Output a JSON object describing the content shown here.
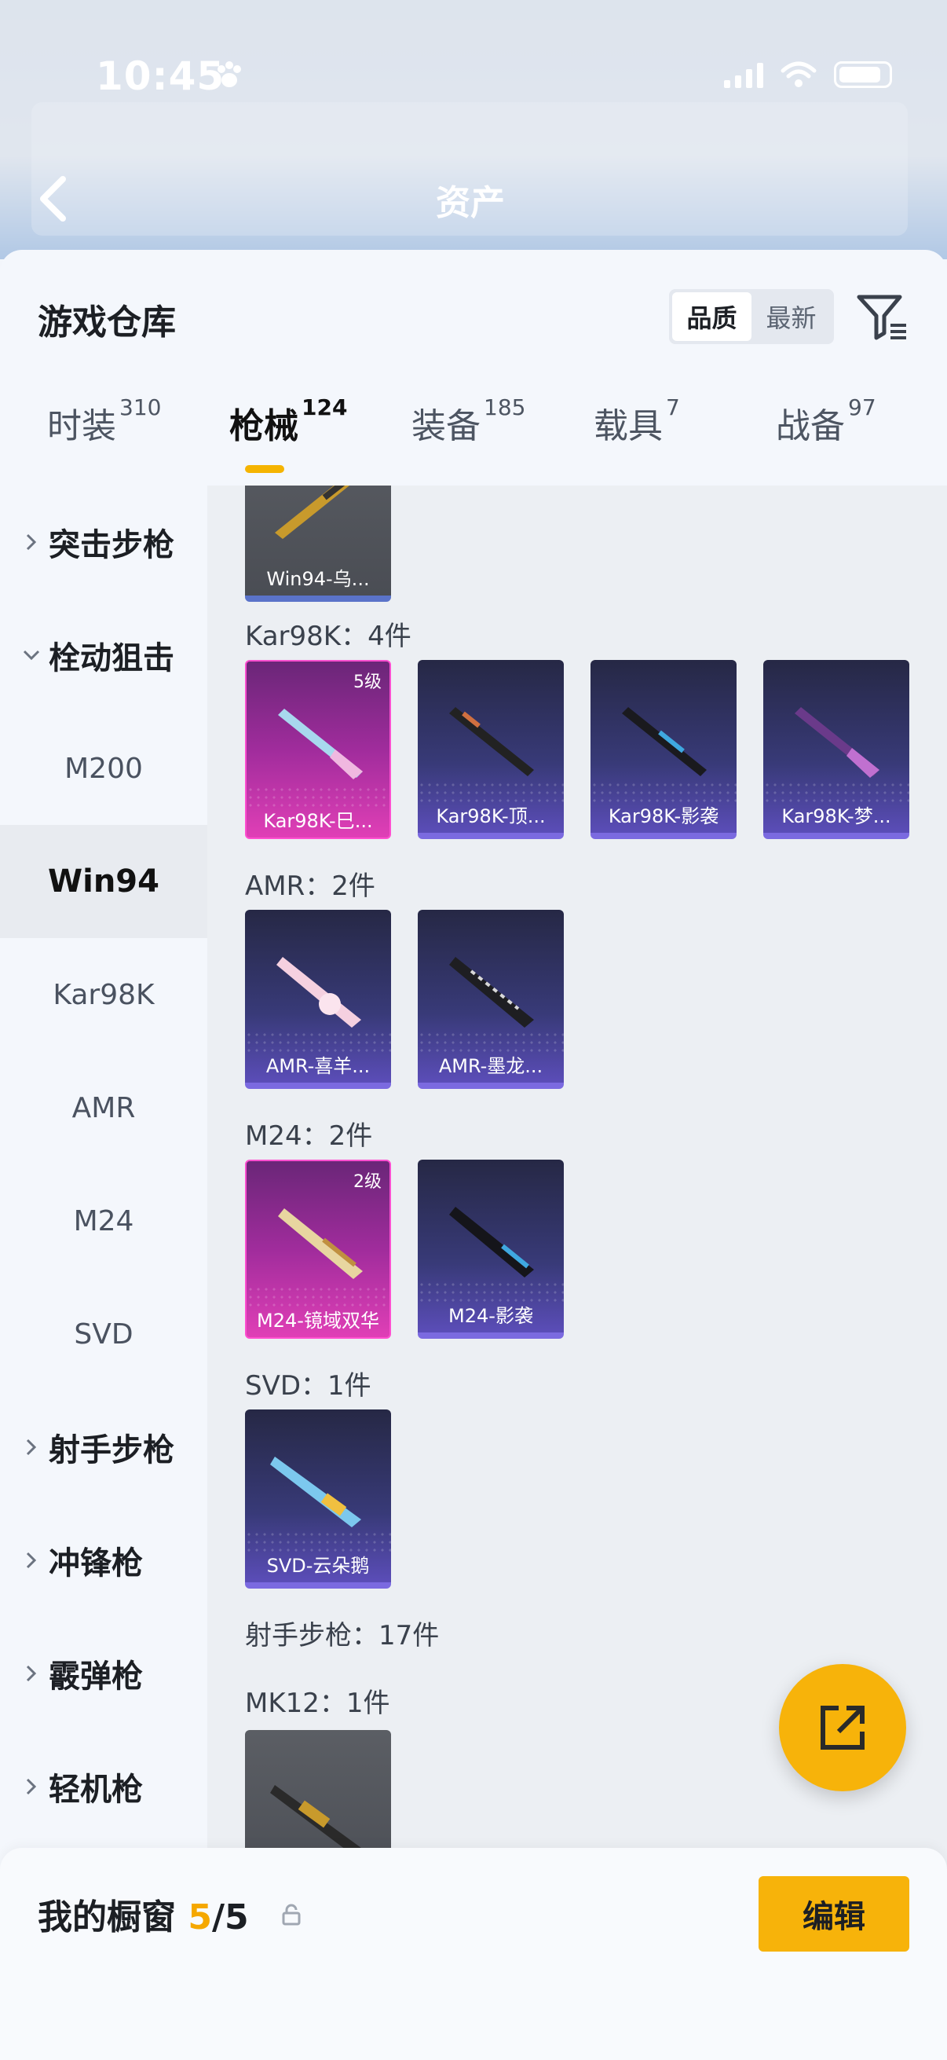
{
  "status_bar": {
    "time": "10:45"
  },
  "header": {
    "title": "资产"
  },
  "sheet": {
    "title": "游戏仓库",
    "sort": {
      "quality": "品质",
      "newest": "最新"
    }
  },
  "tabs": [
    {
      "label": "时装",
      "count": "310"
    },
    {
      "label": "枪械",
      "count": "124"
    },
    {
      "label": "装备",
      "count": "185"
    },
    {
      "label": "载具",
      "count": "7"
    },
    {
      "label": "战备",
      "count": "97"
    }
  ],
  "categories": [
    {
      "label": "突击步枪"
    },
    {
      "label": "栓动狙击"
    },
    {
      "label": "M200"
    },
    {
      "label": "Win94"
    },
    {
      "label": "Kar98K"
    },
    {
      "label": "AMR"
    },
    {
      "label": "M24"
    },
    {
      "label": "SVD"
    },
    {
      "label": "射手步枪"
    },
    {
      "label": "冲锋枪"
    },
    {
      "label": "霰弹枪"
    },
    {
      "label": "轻机枪"
    }
  ],
  "sections": {
    "kar98k": "Kar98K：4件",
    "amr": "AMR：2件",
    "m24": "M24：2件",
    "svd": "SVD：1件",
    "marksman": "射手步枪：17件",
    "mk12": "MK12：1件"
  },
  "cards": {
    "win94": {
      "name": "Win94-乌..."
    },
    "kar1": {
      "name": "Kar98K-巳...",
      "level": "5级"
    },
    "kar2": {
      "name": "Kar98K-顶..."
    },
    "kar3": {
      "name": "Kar98K-影袭"
    },
    "kar4": {
      "name": "Kar98K-梦..."
    },
    "amr1": {
      "name": "AMR-喜羊..."
    },
    "amr2": {
      "name": "AMR-墨龙..."
    },
    "m241": {
      "name": "M24-镜域双华",
      "level": "2级"
    },
    "m242": {
      "name": "M24-影袭"
    },
    "svd1": {
      "name": "SVD-云朵鹅"
    }
  },
  "bottom_bar": {
    "label": "我的橱窗",
    "current": "5",
    "separator": "/",
    "total": "5",
    "edit": "编辑"
  },
  "colors": {
    "accent": "#f7b30a",
    "pink_rarity": "#e03fb6",
    "purple_rarity": "#5b4db8"
  }
}
